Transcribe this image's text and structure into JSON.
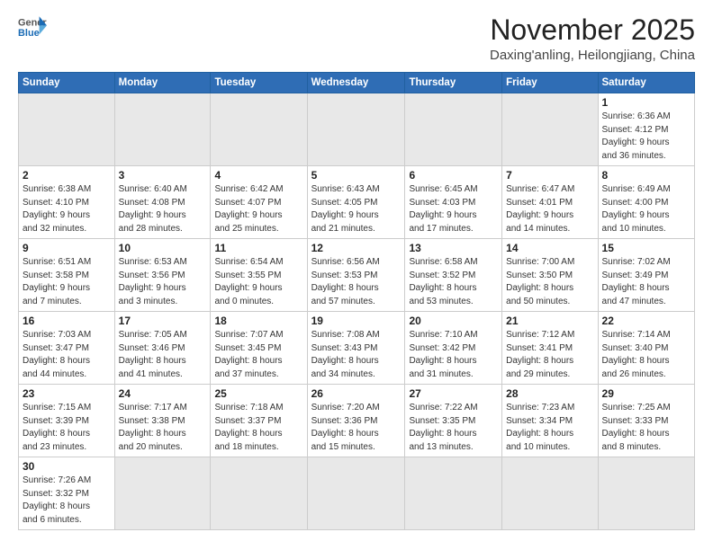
{
  "header": {
    "logo_line1": "General",
    "logo_line2": "Blue",
    "month": "November 2025",
    "location": "Daxing'anling, Heilongjiang, China"
  },
  "weekdays": [
    "Sunday",
    "Monday",
    "Tuesday",
    "Wednesday",
    "Thursday",
    "Friday",
    "Saturday"
  ],
  "weeks": [
    [
      {
        "day": "",
        "info": ""
      },
      {
        "day": "",
        "info": ""
      },
      {
        "day": "",
        "info": ""
      },
      {
        "day": "",
        "info": ""
      },
      {
        "day": "",
        "info": ""
      },
      {
        "day": "",
        "info": ""
      },
      {
        "day": "1",
        "info": "Sunrise: 6:36 AM\nSunset: 4:12 PM\nDaylight: 9 hours\nand 36 minutes."
      }
    ],
    [
      {
        "day": "2",
        "info": "Sunrise: 6:38 AM\nSunset: 4:10 PM\nDaylight: 9 hours\nand 32 minutes."
      },
      {
        "day": "3",
        "info": "Sunrise: 6:40 AM\nSunset: 4:08 PM\nDaylight: 9 hours\nand 28 minutes."
      },
      {
        "day": "4",
        "info": "Sunrise: 6:42 AM\nSunset: 4:07 PM\nDaylight: 9 hours\nand 25 minutes."
      },
      {
        "day": "5",
        "info": "Sunrise: 6:43 AM\nSunset: 4:05 PM\nDaylight: 9 hours\nand 21 minutes."
      },
      {
        "day": "6",
        "info": "Sunrise: 6:45 AM\nSunset: 4:03 PM\nDaylight: 9 hours\nand 17 minutes."
      },
      {
        "day": "7",
        "info": "Sunrise: 6:47 AM\nSunset: 4:01 PM\nDaylight: 9 hours\nand 14 minutes."
      },
      {
        "day": "8",
        "info": "Sunrise: 6:49 AM\nSunset: 4:00 PM\nDaylight: 9 hours\nand 10 minutes."
      }
    ],
    [
      {
        "day": "9",
        "info": "Sunrise: 6:51 AM\nSunset: 3:58 PM\nDaylight: 9 hours\nand 7 minutes."
      },
      {
        "day": "10",
        "info": "Sunrise: 6:53 AM\nSunset: 3:56 PM\nDaylight: 9 hours\nand 3 minutes."
      },
      {
        "day": "11",
        "info": "Sunrise: 6:54 AM\nSunset: 3:55 PM\nDaylight: 9 hours\nand 0 minutes."
      },
      {
        "day": "12",
        "info": "Sunrise: 6:56 AM\nSunset: 3:53 PM\nDaylight: 8 hours\nand 57 minutes."
      },
      {
        "day": "13",
        "info": "Sunrise: 6:58 AM\nSunset: 3:52 PM\nDaylight: 8 hours\nand 53 minutes."
      },
      {
        "day": "14",
        "info": "Sunrise: 7:00 AM\nSunset: 3:50 PM\nDaylight: 8 hours\nand 50 minutes."
      },
      {
        "day": "15",
        "info": "Sunrise: 7:02 AM\nSunset: 3:49 PM\nDaylight: 8 hours\nand 47 minutes."
      }
    ],
    [
      {
        "day": "16",
        "info": "Sunrise: 7:03 AM\nSunset: 3:47 PM\nDaylight: 8 hours\nand 44 minutes."
      },
      {
        "day": "17",
        "info": "Sunrise: 7:05 AM\nSunset: 3:46 PM\nDaylight: 8 hours\nand 41 minutes."
      },
      {
        "day": "18",
        "info": "Sunrise: 7:07 AM\nSunset: 3:45 PM\nDaylight: 8 hours\nand 37 minutes."
      },
      {
        "day": "19",
        "info": "Sunrise: 7:08 AM\nSunset: 3:43 PM\nDaylight: 8 hours\nand 34 minutes."
      },
      {
        "day": "20",
        "info": "Sunrise: 7:10 AM\nSunset: 3:42 PM\nDaylight: 8 hours\nand 31 minutes."
      },
      {
        "day": "21",
        "info": "Sunrise: 7:12 AM\nSunset: 3:41 PM\nDaylight: 8 hours\nand 29 minutes."
      },
      {
        "day": "22",
        "info": "Sunrise: 7:14 AM\nSunset: 3:40 PM\nDaylight: 8 hours\nand 26 minutes."
      }
    ],
    [
      {
        "day": "23",
        "info": "Sunrise: 7:15 AM\nSunset: 3:39 PM\nDaylight: 8 hours\nand 23 minutes."
      },
      {
        "day": "24",
        "info": "Sunrise: 7:17 AM\nSunset: 3:38 PM\nDaylight: 8 hours\nand 20 minutes."
      },
      {
        "day": "25",
        "info": "Sunrise: 7:18 AM\nSunset: 3:37 PM\nDaylight: 8 hours\nand 18 minutes."
      },
      {
        "day": "26",
        "info": "Sunrise: 7:20 AM\nSunset: 3:36 PM\nDaylight: 8 hours\nand 15 minutes."
      },
      {
        "day": "27",
        "info": "Sunrise: 7:22 AM\nSunset: 3:35 PM\nDaylight: 8 hours\nand 13 minutes."
      },
      {
        "day": "28",
        "info": "Sunrise: 7:23 AM\nSunset: 3:34 PM\nDaylight: 8 hours\nand 10 minutes."
      },
      {
        "day": "29",
        "info": "Sunrise: 7:25 AM\nSunset: 3:33 PM\nDaylight: 8 hours\nand 8 minutes."
      }
    ],
    [
      {
        "day": "30",
        "info": "Sunrise: 7:26 AM\nSunset: 3:32 PM\nDaylight: 8 hours\nand 6 minutes."
      },
      {
        "day": "",
        "info": ""
      },
      {
        "day": "",
        "info": ""
      },
      {
        "day": "",
        "info": ""
      },
      {
        "day": "",
        "info": ""
      },
      {
        "day": "",
        "info": ""
      },
      {
        "day": "",
        "info": ""
      }
    ]
  ]
}
